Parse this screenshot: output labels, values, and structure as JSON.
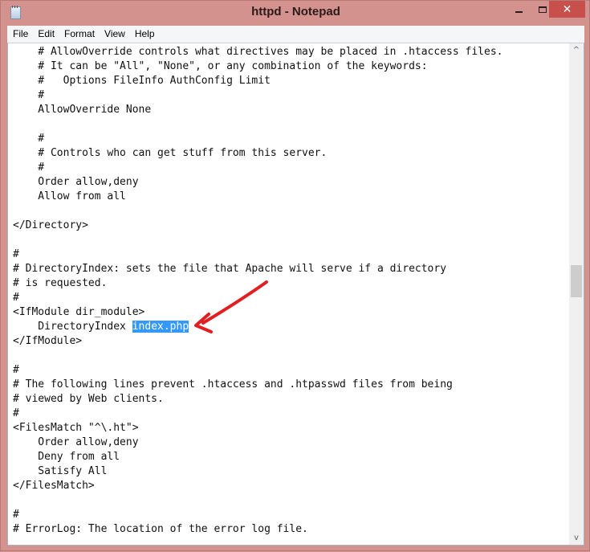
{
  "window": {
    "title": "httpd - Notepad",
    "app_icon": "notepad-icon",
    "controls": {
      "minimize": "minimize-icon",
      "maximize": "maximize-icon",
      "close_label": "✕"
    }
  },
  "menu": {
    "items": [
      {
        "label": "File"
      },
      {
        "label": "Edit"
      },
      {
        "label": "Format"
      },
      {
        "label": "View"
      },
      {
        "label": "Help"
      }
    ]
  },
  "editor": {
    "lines": [
      "    # AllowOverride controls what directives may be placed in .htaccess files.",
      "    # It can be \"All\", \"None\", or any combination of the keywords:",
      "    #   Options FileInfo AuthConfig Limit",
      "    #",
      "    AllowOverride None",
      "",
      "    #",
      "    # Controls who can get stuff from this server.",
      "    #",
      "    Order allow,deny",
      "    Allow from all",
      "",
      "</Directory>",
      "",
      "#",
      "# DirectoryIndex: sets the file that Apache will serve if a directory",
      "# is requested.",
      "#",
      "<IfModule dir_module>",
      "    DirectoryIndex ",
      "</IfModule>",
      "",
      "#",
      "# The following lines prevent .htaccess and .htpasswd files from being",
      "# viewed by Web clients.",
      "#",
      "<FilesMatch \"^\\.ht\">",
      "    Order allow,deny",
      "    Deny from all",
      "    Satisfy All",
      "</FilesMatch>",
      "",
      "#",
      "# ErrorLog: The location of the error log file."
    ],
    "selected_line_index": 19,
    "selected_text": "index.php",
    "selection_color": "#3399ff",
    "annotation": {
      "type": "arrow",
      "color": "#e02020",
      "points_to": "index.php"
    }
  },
  "scrollbar": {
    "up_arrow": "^",
    "down_arrow": "v",
    "position_fraction": 0.47
  }
}
